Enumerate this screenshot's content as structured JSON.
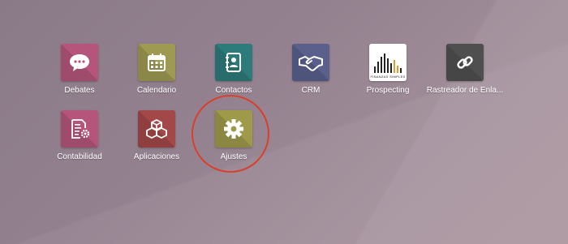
{
  "apps": [
    {
      "label": "Debates",
      "icon": "chat-bubble-icon",
      "color": "#b5557b"
    },
    {
      "label": "Calendario",
      "icon": "calendar-icon",
      "color": "#9e9a52"
    },
    {
      "label": "Contactos",
      "icon": "address-book-icon",
      "color": "#2d7b7a"
    },
    {
      "label": "CRM",
      "icon": "handshake-icon",
      "color": "#5a5f8c"
    },
    {
      "label": "Prospecting",
      "icon": "finanzas-simples-logo",
      "color": "#ffffff"
    },
    {
      "label": "Rastreador de Enla...",
      "icon": "link-icon",
      "color": "#4f4f4f"
    },
    {
      "label": "Contabilidad",
      "icon": "invoice-gear-icon",
      "color": "#b5557b"
    },
    {
      "label": "Aplicaciones",
      "icon": "cubes-icon",
      "color": "#a34848"
    },
    {
      "label": "Ajustes",
      "icon": "gear-icon",
      "color": "#9e9a4a"
    }
  ],
  "prospecting_logo_text": "FINANZAS SIMPLES",
  "highlight": {
    "target": "Ajustes",
    "color": "#d9402c"
  }
}
